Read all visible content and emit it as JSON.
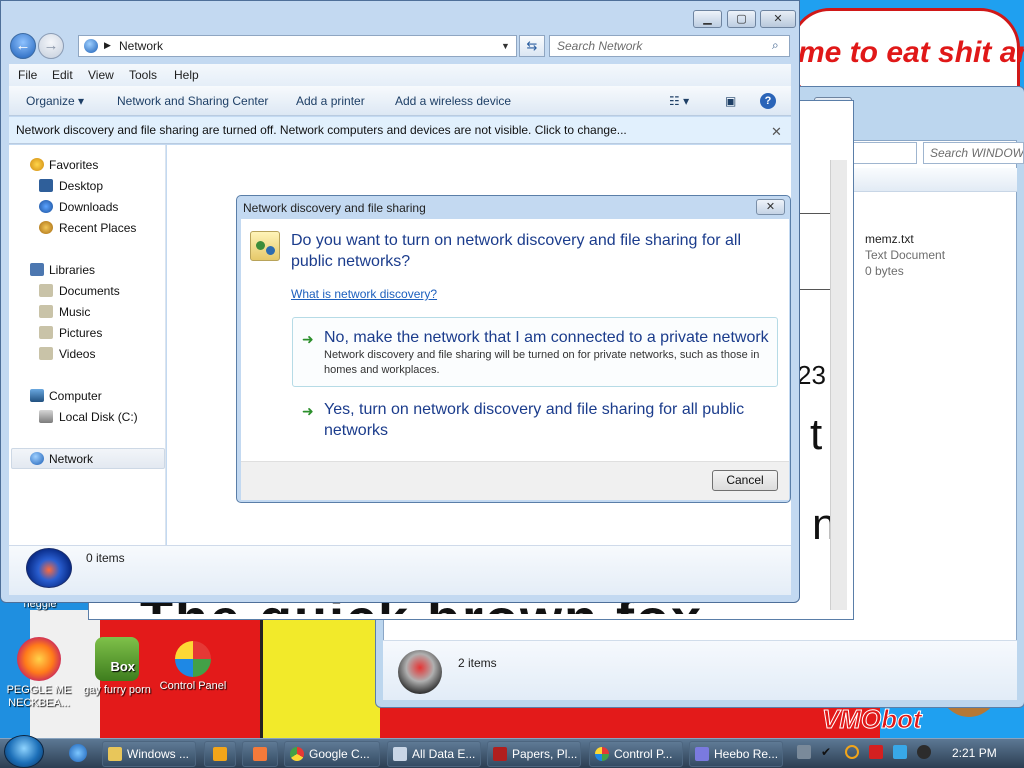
{
  "background": {
    "speech": "me to eat shit and chew",
    "notepad_big_text": "The quick brown fox",
    "notepad_partial_1": "23",
    "notepad_partial_2": "t",
    "notepad_partial_3": "n",
    "watermark": "VMObot"
  },
  "desktop_icons": [
    {
      "label": "heggle"
    },
    {
      "label": "PEGGLE ME NECKBEA..."
    },
    {
      "label": "gay furry porn"
    },
    {
      "label": "Control Panel"
    }
  ],
  "back_window": {
    "search_placeholder": "Search WINDOWS",
    "file_name": "memz.txt",
    "file_type": "Text Document",
    "file_size": "0 bytes",
    "status": "2 items"
  },
  "explorer": {
    "address": "Network",
    "search_placeholder": "Search Network",
    "menu": [
      "File",
      "Edit",
      "View",
      "Tools",
      "Help"
    ],
    "toolbar": {
      "organize": "Organize",
      "sharing_center": "Network and Sharing Center",
      "add_printer": "Add a printer",
      "add_wireless": "Add a wireless device"
    },
    "infobar": "Network discovery and file sharing are turned off. Network computers and devices are not visible. Click to change...",
    "nav": {
      "favorites": "Favorites",
      "desktop": "Desktop",
      "downloads": "Downloads",
      "recent": "Recent Places",
      "libraries": "Libraries",
      "documents": "Documents",
      "music": "Music",
      "pictures": "Pictures",
      "videos": "Videos",
      "computer": "Computer",
      "local_disk": "Local Disk (C:)",
      "network": "Network"
    },
    "status": "0 items"
  },
  "dialog": {
    "title": "Network discovery and file sharing",
    "question": "Do you want to turn on network discovery and file sharing for all public networks?",
    "link": "What is network discovery?",
    "option1_title": "No, make the network that I am connected to a private network",
    "option1_desc": "Network discovery and file sharing will be turned on for private networks, such as those in homes and workplaces.",
    "option2_title": "Yes, turn on network discovery and file sharing for all public networks",
    "cancel": "Cancel"
  },
  "taskbar": {
    "buttons": [
      "Windows ...",
      "Google C...",
      "All Data E...",
      "Papers, Pl...",
      "Control P...",
      "Heebo Re..."
    ],
    "clock": "2:21 PM"
  },
  "colors": {
    "accent_blue": "#1b3c8c",
    "link_blue": "#1c5fbd",
    "green_arrow": "#2b8f2b",
    "infobar_bg": "#e1f0fd"
  }
}
